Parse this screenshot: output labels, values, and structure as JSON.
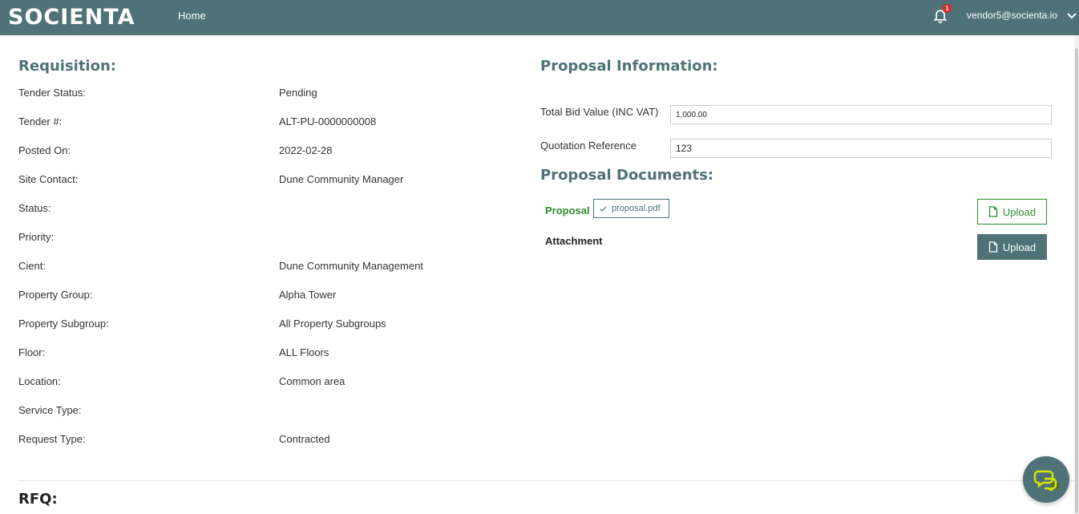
{
  "header": {
    "logo": "SOCIENTA",
    "nav_home": "Home",
    "notification_count": "1",
    "user_email": "vendor5@socienta.io"
  },
  "requisition": {
    "title": "Requisition:",
    "rows": [
      {
        "label": "Tender Status:",
        "value": "Pending"
      },
      {
        "label": "Tender #:",
        "value": "ALT-PU-0000000008"
      },
      {
        "label": "Posted On:",
        "value": "2022-02-28"
      },
      {
        "label": "Site Contact:",
        "value": "Dune Community Manager"
      },
      {
        "label": "Status:",
        "value": ""
      },
      {
        "label": "Priority:",
        "value": ""
      },
      {
        "label": "Cient:",
        "value": "Dune Community Management"
      },
      {
        "label": "Property Group:",
        "value": "Alpha Tower"
      },
      {
        "label": "Property Subgroup:",
        "value": "All Property Subgroups"
      },
      {
        "label": "Floor:",
        "value": "ALL Floors"
      },
      {
        "label": "Location:",
        "value": "Common area"
      },
      {
        "label": "Service Type:",
        "value": ""
      },
      {
        "label": "Request Type:",
        "value": "Contracted"
      }
    ]
  },
  "proposal_info": {
    "title": "Proposal Information:",
    "total_bid_label": "Total Bid Value (INC VAT)",
    "total_bid_value": "1,000.00",
    "quotation_label": "Quotation Reference",
    "quotation_value": "123"
  },
  "proposal_documents": {
    "title": "Proposal Documents:",
    "proposal_label": "Proposal",
    "proposal_file": "proposal.pdf",
    "attachment_label": "Attachment",
    "upload_label": "Upload"
  },
  "rfq": {
    "title": "RFQ:"
  },
  "colors": {
    "brand": "#4f7278",
    "success": "#2e8b2e",
    "badge": "#e02424"
  }
}
